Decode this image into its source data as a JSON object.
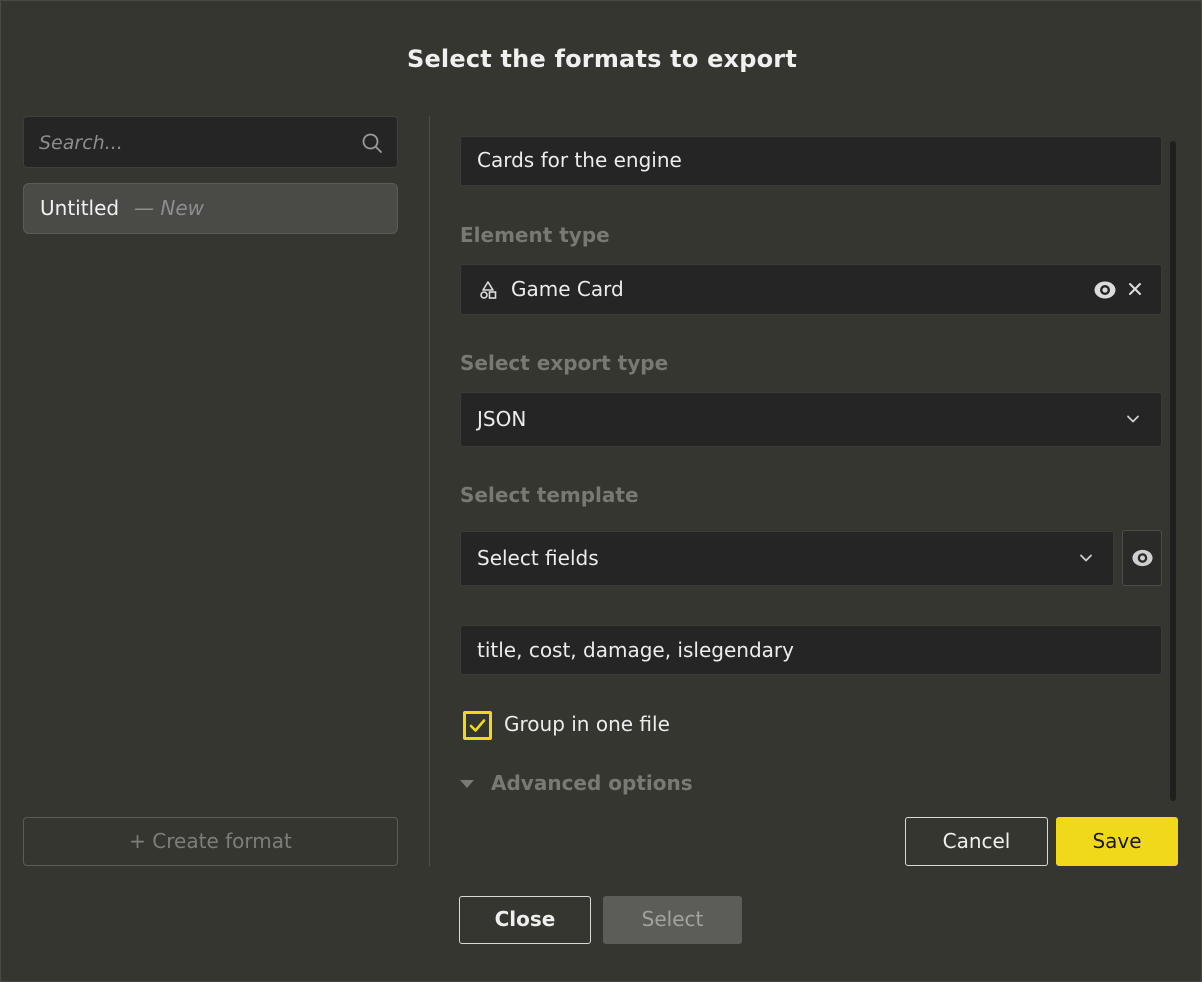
{
  "dialog": {
    "title": "Select the formats to export"
  },
  "left_panel": {
    "search": {
      "placeholder": "Search...",
      "value": "",
      "icon": "search-icon"
    },
    "formats": [
      {
        "name": "Untitled",
        "status": "— New"
      }
    ],
    "create_label": "+ Create format"
  },
  "right_panel": {
    "format_name": "Cards for the engine",
    "element_type": {
      "label": "Element type",
      "value": "Game Card",
      "icon": "shapes-icon"
    },
    "export_type": {
      "label": "Select export type",
      "value": "JSON"
    },
    "template": {
      "label": "Select template",
      "value": "Select fields"
    },
    "fields_value": "title, cost, damage, islegendary",
    "group_in_one_file": {
      "label": "Group in one file",
      "checked": true
    },
    "advanced_label": "Advanced options",
    "cancel_label": "Cancel",
    "save_label": "Save"
  },
  "footer": {
    "close_label": "Close",
    "select_label": "Select"
  },
  "colors": {
    "background": "#363631",
    "input_bg": "#252525",
    "accent": "#f0d81a",
    "muted_label": "#797974"
  }
}
